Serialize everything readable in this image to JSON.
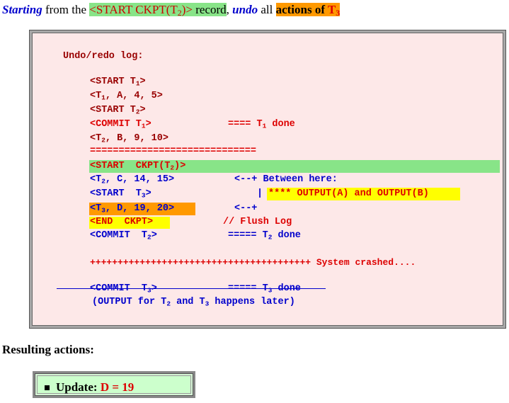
{
  "heading": {
    "word1": "Starting",
    "word2": " from the ",
    "ckpt": "<START CKPT(T",
    "ckpt_sub": "2",
    "ckpt_end": ")>",
    "word3": " record",
    "word4": ", ",
    "undo": "undo",
    "word5": " all ",
    "actions": "actions of ",
    "t3": "T",
    "t3_sub": "3"
  },
  "log": {
    "title": "Undo/redo log:",
    "l1": "<START T",
    "l1s": "1",
    "l1e": ">",
    "l2a": "<T",
    "l2s": "1",
    "l2b": ", A, 4, 5>",
    "l3": "<START T",
    "l3s": "2",
    "l3e": ">",
    "l4": "<COMMIT T",
    "l4s": "1",
    "l4e": ">",
    "l4note": "==== T",
    "l4ns": "1",
    "l4ne": " done",
    "l5a": "<T",
    "l5s": "2",
    "l5b": ", B, 9, 10>",
    "sep": "=============================",
    "l6": "<START  CKPT(T",
    "l6s": "2",
    "l6e": ")>",
    "l7a": "<T",
    "l7s": "2",
    "l7b": ", C, 14, 15>",
    "l7note": "<--+ Between here:",
    "l8": "<START  T",
    "l8s": "3",
    "l8e": ">",
    "l8bar": "|",
    "l8note": "**** OUTPUT(A) and OUTPUT(B)",
    "l9a": "<T",
    "l9s": "3",
    "l9b": ", D, 19, 20>",
    "l9note": "<--+",
    "l10": "<END  CKPT>",
    "l10note": "// Flush Log",
    "l11": "<COMMIT  T",
    "l11s": "2",
    "l11e": ">",
    "l11note": "===== T",
    "l11ns": "2",
    "l11ne": " done",
    "crash": "++++++++++++++++++++++++++++++++++++++++ System crashed....",
    "l12": "<COMMIT  T",
    "l12s": "3",
    "l12e": ">",
    "l12note": "===== T",
    "l12ns": "3",
    "l12ne": " done",
    "l13a": "(OUTPUT for T",
    "l13s1": "2",
    "l13b": " and T",
    "l13s2": "3",
    "l13c": " happens later)"
  },
  "result": {
    "heading": "Resulting actions:",
    "label": "Update: ",
    "value": "D = 19"
  }
}
